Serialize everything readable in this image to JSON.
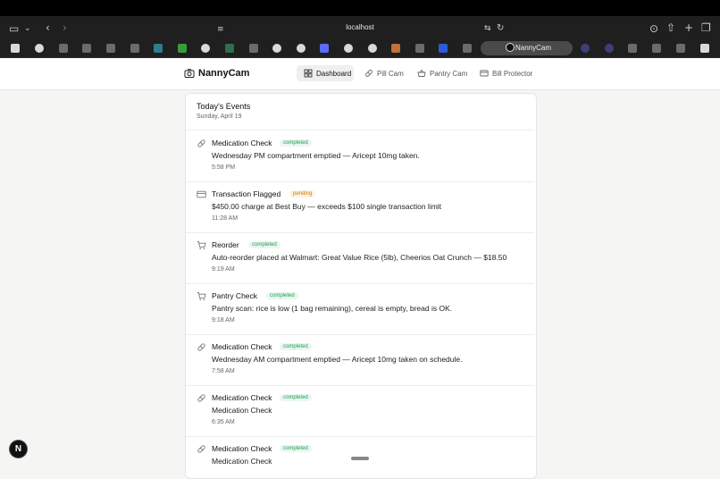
{
  "browser": {
    "url": "localhost",
    "active_tab_label": "NannyCam"
  },
  "app": {
    "brand": "NannyCam",
    "nav": [
      {
        "label": "Dashboard",
        "active": true,
        "icon": "grid-icon"
      },
      {
        "label": "Pill Cam",
        "active": false,
        "icon": "pill-icon"
      },
      {
        "label": "Pantry Cam",
        "active": false,
        "icon": "basket-icon"
      },
      {
        "label": "Bill Protector",
        "active": false,
        "icon": "card-icon"
      }
    ]
  },
  "events_panel": {
    "title": "Today's Events",
    "date": "Sunday, April 19",
    "events": [
      {
        "icon": "pill-icon",
        "title": "Medication Check",
        "status": "completed",
        "desc": "Wednesday PM compartment emptied — Aricept 10mg taken.",
        "time": "5:58 PM"
      },
      {
        "icon": "card-icon",
        "title": "Transaction Flagged",
        "status": "pending",
        "desc": "$450.00 charge at Best Buy — exceeds $100 single transaction limit",
        "time": "11:28 AM"
      },
      {
        "icon": "cart-icon",
        "title": "Reorder",
        "status": "completed",
        "desc": "Auto-reorder placed at Walmart: Great Value Rice (5lb), Cheerios Oat Crunch — $18.50",
        "time": "9:19 AM"
      },
      {
        "icon": "cart-icon",
        "title": "Pantry Check",
        "status": "completed",
        "desc": "Pantry scan: rice is low (1 bag remaining), cereal is empty, bread is OK.",
        "time": "9:18 AM"
      },
      {
        "icon": "pill-icon",
        "title": "Medication Check",
        "status": "completed",
        "desc": "Wednesday AM compartment emptied — Aricept 10mg taken on schedule.",
        "time": "7:58 AM"
      },
      {
        "icon": "pill-icon",
        "title": "Medication Check",
        "status": "completed",
        "desc": "Medication Check",
        "time": "6:35 AM"
      },
      {
        "icon": "pill-icon",
        "title": "Medication Check",
        "status": "completed",
        "desc": "Medication Check",
        "time": ""
      }
    ]
  },
  "avatar_letter": "N"
}
